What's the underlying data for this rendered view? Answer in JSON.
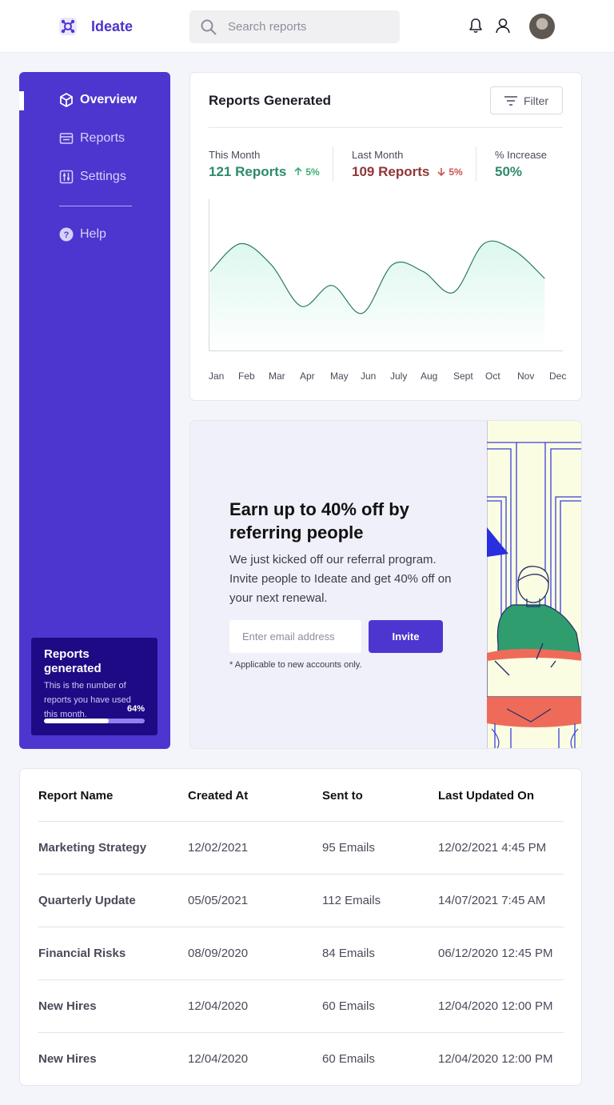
{
  "app": {
    "name": "Ideate",
    "accent": "#4c36cf"
  },
  "header": {
    "search_placeholder": "Search reports",
    "icons": [
      "search-icon",
      "bell-icon",
      "user-icon",
      "avatar"
    ]
  },
  "sidebar": {
    "items": [
      {
        "label": "Overview",
        "icon": "cube-icon",
        "active": true
      },
      {
        "label": "Reports",
        "icon": "reports-icon",
        "active": false
      },
      {
        "label": "Settings",
        "icon": "sliders-icon",
        "active": false
      },
      {
        "label": "Help",
        "icon": "help-icon",
        "active": false
      }
    ],
    "usage_card": {
      "title": "Reports generated",
      "description": "This is the number of reports you have used this month.",
      "percent_label": "64%",
      "progress": 0.64
    }
  },
  "reports": {
    "title": "Reports Generated",
    "filter_label": "Filter",
    "stats": [
      {
        "label": "This Month",
        "value": "121 Reports",
        "change": "5%",
        "direction": "up"
      },
      {
        "label": "Last Month",
        "value": "109 Reports",
        "change": "5%",
        "direction": "down"
      },
      {
        "label": "% Increase",
        "value": "50%"
      }
    ]
  },
  "chart_data": {
    "type": "area",
    "categories": [
      "Jan",
      "Feb",
      "Mar",
      "Apr",
      "May",
      "Jun",
      "July",
      "Aug",
      "Sept",
      "Oct",
      "Nov",
      "Dec"
    ],
    "values": [
      55,
      75,
      60,
      30,
      45,
      25,
      60,
      55,
      40,
      75,
      70,
      50
    ],
    "grid": false,
    "colors": {
      "line": "#2e7d5b",
      "fill": "#e4f8f1"
    }
  },
  "referral": {
    "title": "Earn up to 40% off by referring people",
    "text": "We just kicked off our referral program. Invite people to Ideate and get 40% off on your next renewal.",
    "email_placeholder": "Enter email address",
    "invite_label": "Invite",
    "note": "* Applicable to new accounts only."
  },
  "table": {
    "headers": [
      "Report Name",
      "Created At",
      "Sent to",
      "Last Updated On"
    ],
    "rows": [
      {
        "name": "Marketing Strategy",
        "created": "12/02/2021",
        "sent": "95 Emails",
        "updated": "12/02/2021 4:45 PM"
      },
      {
        "name": "Quarterly Update",
        "created": "05/05/2021",
        "sent": "112 Emails",
        "updated": "14/07/2021 7:45 AM"
      },
      {
        "name": "Financial Risks",
        "created": "08/09/2020",
        "sent": "84 Emails",
        "updated": "06/12/2020 12:45 PM"
      },
      {
        "name": "New Hires",
        "created": "12/04/2020",
        "sent": "60 Emails",
        "updated": "12/04/2020 12:00 PM"
      },
      {
        "name": "New Hires",
        "created": "12/04/2020",
        "sent": "60 Emails",
        "updated": "12/04/2020 12:00 PM"
      }
    ]
  }
}
